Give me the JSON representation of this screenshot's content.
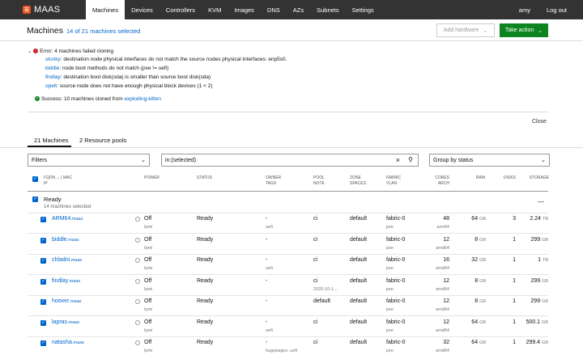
{
  "nav": {
    "logo": "MAAS",
    "items": [
      "Machines",
      "Devices",
      "Controllers",
      "KVM",
      "Images",
      "DNS",
      "AZs",
      "Subnets",
      "Settings"
    ],
    "user": "amy",
    "logout": "Log out"
  },
  "header": {
    "title": "Machines",
    "selected": "14 of 21 machines selected",
    "add_hardware": "Add hardware",
    "take_action": "Take action"
  },
  "notifications": {
    "error_prefix": "Error:",
    "error_text": "4 machines failed cloning",
    "errors": [
      {
        "name": "stunky",
        "msg": ": destination node physical interfaces do not match the source nodes physical interfaces: enp5s0."
      },
      {
        "name": "biddle",
        "msg": ": node boot methods do not match (pxe != uefi)"
      },
      {
        "name": "findlay",
        "msg": ": destination boot disk(sda) is smaller than source boot disk(sda)"
      },
      {
        "name": "opelt",
        "msg": ": source node does not have enough physical block devices (1 < 2)"
      }
    ],
    "success_prefix": "Success:",
    "success_text": "10 machines cloned from",
    "success_source": "exploding-kitten",
    "close": "Close"
  },
  "tabs": [
    "21 Machines",
    "2 Resource pools"
  ],
  "filters": {
    "filters_label": "Filters",
    "search_value": "in:(selected)",
    "group_by": "Group by status"
  },
  "columns": {
    "fqdn_line1": "FQDN ⌄ | MAC",
    "fqdn_line2": "IP",
    "power": "POWER",
    "status": "STATUS",
    "owner_line1": "OWNER",
    "owner_line2": "TAGS",
    "pool_line1": "POOL",
    "pool_line2": "NOTE",
    "zone_line1": "ZONE",
    "zone_line2": "SPACES",
    "fabric_line1": "FABRIC",
    "fabric_line2": "VLAN",
    "cores_line1": "CORES",
    "cores_line2": "ARCH",
    "ram": "RAM",
    "disks": "DISKS",
    "storage": "STORAGE"
  },
  "group": {
    "title": "Ready",
    "subtitle": "14 machines selected",
    "collapse": "—"
  },
  "rows": [
    {
      "host": "ARM64",
      "domain": ".maas",
      "power": "Off",
      "power_type": "Ipmi",
      "status": "Ready",
      "owner": "-",
      "tags": "uefi",
      "pool": "ci",
      "note": "",
      "zone": "default",
      "fabric": "fabric-0",
      "vlan": "pxe",
      "cores": "48",
      "arch": "arm64",
      "ram": "64",
      "ram_unit": "GB",
      "disks": "3",
      "storage": "2.24",
      "storage_unit": "TB"
    },
    {
      "host": "biddle",
      "domain": ".maas",
      "power": "Off",
      "power_type": "Ipmi",
      "status": "Ready",
      "owner": "-",
      "tags": "",
      "pool": "ci",
      "note": "",
      "zone": "default",
      "fabric": "fabric-0",
      "vlan": "pxe",
      "cores": "12",
      "arch": "amd64",
      "ram": "8",
      "ram_unit": "GB",
      "disks": "1",
      "storage": "299",
      "storage_unit": "GB"
    },
    {
      "host": "chladni",
      "domain": ".maas",
      "power": "Off",
      "power_type": "Ipmi",
      "status": "Ready",
      "owner": "-",
      "tags": "uefi",
      "pool": "ci",
      "note": "",
      "zone": "default",
      "fabric": "fabric-0",
      "vlan": "pxe",
      "cores": "16",
      "arch": "amd64",
      "ram": "32",
      "ram_unit": "GB",
      "disks": "1",
      "storage": "1",
      "storage_unit": "TB"
    },
    {
      "host": "findlay",
      "domain": ".maas",
      "power": "Off",
      "power_type": "Ipmi",
      "status": "Ready",
      "owner": "-",
      "tags": "",
      "pool": "ci",
      "note": "2020-10-1...",
      "zone": "default",
      "fabric": "fabric-0",
      "vlan": "pxe",
      "cores": "12",
      "arch": "amd64",
      "ram": "8",
      "ram_unit": "GB",
      "disks": "1",
      "storage": "299",
      "storage_unit": "GB"
    },
    {
      "host": "hoover",
      "domain": ".maas",
      "power": "Off",
      "power_type": "Ipmi",
      "status": "Ready",
      "owner": "-",
      "tags": "",
      "pool": "default",
      "note": "",
      "zone": "default",
      "fabric": "fabric-0",
      "vlan": "pxe",
      "cores": "12",
      "arch": "amd64",
      "ram": "8",
      "ram_unit": "GB",
      "disks": "1",
      "storage": "299",
      "storage_unit": "GB"
    },
    {
      "host": "lapras",
      "domain": ".maas",
      "power": "Off",
      "power_type": "Ipmi",
      "status": "Ready",
      "owner": "-",
      "tags": "uefi",
      "pool": "ci",
      "note": "",
      "zone": "default",
      "fabric": "fabric-0",
      "vlan": "pxe",
      "cores": "12",
      "arch": "amd64",
      "ram": "64",
      "ram_unit": "GB",
      "disks": "1",
      "storage": "500.1",
      "storage_unit": "GB"
    },
    {
      "host": "natasha",
      "domain": ".maas",
      "power": "Off",
      "power_type": "Ipmi",
      "status": "Ready",
      "owner": "-",
      "tags": "hugepages, uefi",
      "pool": "ci",
      "note": "",
      "zone": "default",
      "fabric": "fabric-0",
      "vlan": "pxe",
      "cores": "32",
      "arch": "amd64",
      "ram": "64",
      "ram_unit": "GB",
      "disks": "1",
      "storage": "299.4",
      "storage_unit": "GB"
    }
  ]
}
